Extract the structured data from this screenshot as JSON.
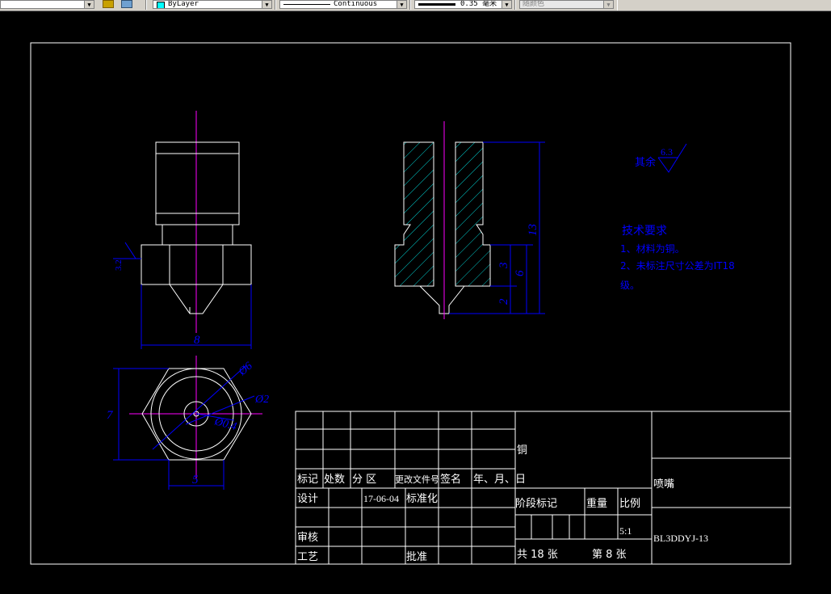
{
  "toolbar": {
    "layer_combo": "ByLayer",
    "linetype_combo": "Continuous",
    "lineweight_combo": "0.35 毫米",
    "plotstyle_combo": "随颜色"
  },
  "colors": {
    "background": "#000000",
    "lines": "#ffffff",
    "centerline": "#ff00ff",
    "dimension": "#0000ff",
    "hatch": "#00ffff",
    "text": "#ffffff"
  },
  "dimensions": {
    "front_width": "8",
    "hex_height": "7",
    "hex_flat": "5",
    "dia_6": "Ø6",
    "dia_2": "Ø2",
    "dia_0_4": "Ø0.4",
    "overall_height": "13",
    "body_height": "6",
    "flange_height": "3",
    "tip_height": "2",
    "front_surface_rough": "3.2",
    "general_rough": "6.3",
    "general_rough_label": "其余"
  },
  "notes": {
    "title": "技术要求",
    "line1": "1、材料为铜。",
    "line2": "2、未标注尺寸公差为IT18",
    "line3": "级。"
  },
  "title_block": {
    "material": "铜",
    "part_name": "喷嘴",
    "drawing_no": "BL3DDYJ-13",
    "h_mark": "标记",
    "h_count": "处数",
    "h_zone": "分 区",
    "h_change_doc": "更改文件号",
    "h_sign": "签名",
    "h_date": "年、月、日",
    "design": "设计",
    "design_date": "17-06-04",
    "standardize": "标准化",
    "check": "审核",
    "process": "工艺",
    "approve": "批准",
    "stage_mark": "阶段标记",
    "weight": "重量",
    "scale_label": "比例",
    "scale": "5:1",
    "total_sheets": "共  18  张",
    "sheet_no": "第  8  张"
  }
}
